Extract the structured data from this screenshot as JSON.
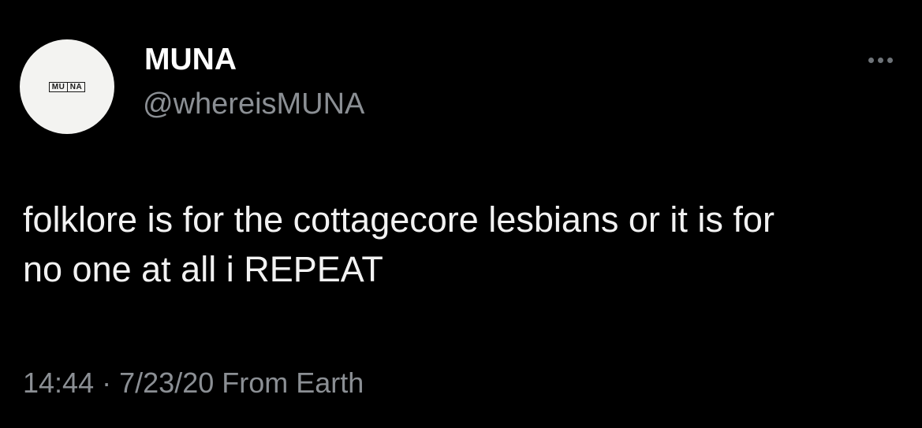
{
  "tweet": {
    "avatar": {
      "logo_left": "MU",
      "logo_right": "NA"
    },
    "display_name": "MUNA",
    "handle": "@whereisMUNA",
    "more_icon": "more-horizontal-icon",
    "text_line1": "folklore is for the cottagecore lesbians or it is for",
    "text_line2": "no one at all i REPEAT",
    "time": "14:44",
    "separator": "·",
    "date": "7/23/20",
    "source": "From Earth"
  },
  "colors": {
    "background": "#000000",
    "primary_text": "#ffffff",
    "secondary_text": "#8b8f94",
    "avatar_bg": "#f3f3f1"
  }
}
